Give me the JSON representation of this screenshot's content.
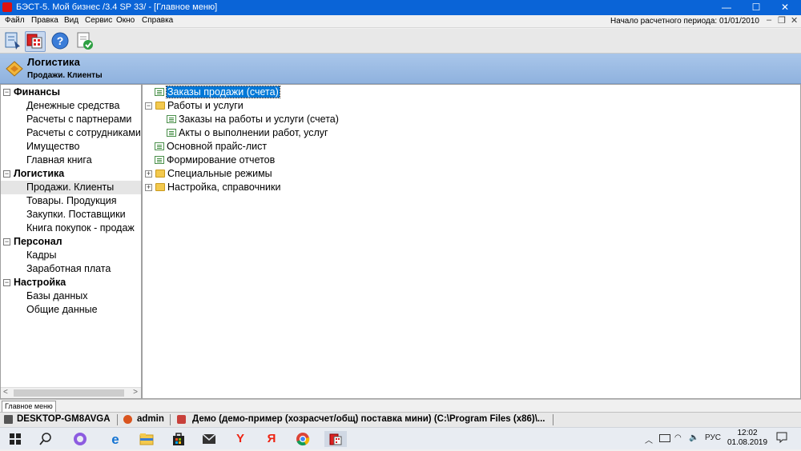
{
  "window": {
    "title": "БЭСТ-5. Мой бизнес /3.4 SP 33/ - [Главное меню]",
    "minimize": "—",
    "maximize": "☐",
    "close": "✕"
  },
  "menu": {
    "items": [
      "Файл",
      "Правка",
      "Вид",
      "Сервис",
      "Окно",
      "Справка"
    ],
    "period": "Начало расчетного периода: 01/01/2010",
    "mdi_minimize": "–",
    "mdi_restore": "❐",
    "mdi_close": "✕"
  },
  "toolbar": {
    "icons": [
      "menu-icon",
      "calculator-icon",
      "help-icon",
      "document-check-icon"
    ]
  },
  "header": {
    "title": "Логистика",
    "subtitle": "Продажи. Клиенты"
  },
  "nav": {
    "groups": [
      {
        "label": "Финансы",
        "toggle": "−",
        "items": [
          "Денежные средства",
          "Расчеты с партнерами",
          "Расчеты с сотрудниками",
          "Имущество",
          "Главная книга"
        ]
      },
      {
        "label": "Логистика",
        "toggle": "−",
        "items": [
          "Продажи. Клиенты",
          "Товары. Продукция",
          "Закупки. Поставщики",
          "Книга покупок - продаж"
        ]
      },
      {
        "label": "Персонал",
        "toggle": "−",
        "items": [
          "Кадры",
          "Заработная плата"
        ]
      },
      {
        "label": "Настройка",
        "toggle": "−",
        "items": [
          "Базы данных",
          "Общие данные"
        ]
      }
    ],
    "selected": "Продажи. Клиенты"
  },
  "scroll": {
    "left": "<",
    "right": ">"
  },
  "tree": {
    "nodes": [
      {
        "label": "Заказы продажи (счета)",
        "icon": "list-icon",
        "selected": true
      },
      {
        "label": "Работы и услуги",
        "icon": "folder-icon",
        "toggle": "−"
      },
      {
        "label": "Заказы на работы и услуги (счета)",
        "icon": "list-icon"
      },
      {
        "label": "Акты о выполнении работ, услуг",
        "icon": "list-icon"
      },
      {
        "label": "Основной прайс-лист",
        "icon": "list-icon"
      },
      {
        "label": "Формирование отчетов",
        "icon": "list-icon"
      },
      {
        "label": "Специальные режимы",
        "icon": "folder-icon",
        "toggle": "+"
      },
      {
        "label": "Настройка, справочники",
        "icon": "folder-icon",
        "toggle": "+"
      }
    ]
  },
  "mdi_tab": "Главное меню",
  "status": {
    "computer": "DESKTOP-GM8AVGA",
    "user": "admin",
    "database": "Демо (демо-пример (хозрасчет/общ) поставка мини) (C:\\Program Files (x86)\\..."
  },
  "taskbar": {
    "lang": "РУС",
    "time": "12:02",
    "date": "01.08.2019",
    "apps": [
      "windows-start-icon",
      "search-icon",
      "cortana-icon",
      "edge-icon",
      "explorer-icon",
      "store-icon",
      "mail-icon",
      "yandex-icon",
      "yandex-browser-icon",
      "chrome-icon",
      "best5-icon"
    ]
  },
  "colors": {
    "titlebar": "#0a64d7",
    "selection": "#0078d7",
    "header": "#a9c6ea"
  }
}
